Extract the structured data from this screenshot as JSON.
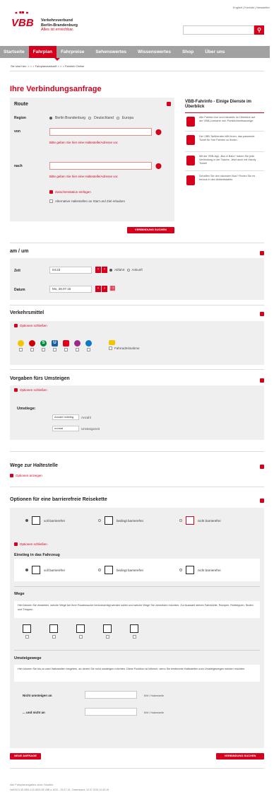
{
  "toplinks": [
    "English",
    "Kontakt",
    "Newsletter"
  ],
  "logo": {
    "mark": "VBB",
    "line1": "Verkehrsverbund",
    "line2": "Berlin-Brandenburg",
    "line3": "Alles ist erreichbar."
  },
  "nav": [
    "Startseite",
    "Fahrplan",
    "Fahrpreise",
    "Sehenswertes",
    "Wissenswertes",
    "Shop",
    "Über uns"
  ],
  "breadcrumb": "Sie sind hier: > > > Fahrplanauskunft > > > Fahrinfo Online",
  "page_title": "Ihre Verbindungsanfrage",
  "route": {
    "heading": "Route",
    "region_label": "Region",
    "regions": [
      "Berlin Brandenburg",
      "Deutschland",
      "Europa"
    ],
    "von_label": "von",
    "nach_label": "nach",
    "hint": "Bitte geben Sie hier eine Haltestelle/Adresse vor.",
    "zwischen": "Zwischenstation einfügen",
    "alternative": "Alternative Haltestellen an Start und Ziel erlauben"
  },
  "sidebar": {
    "title": "VBB-Fahrinfo - Einige Dienste im Überblick",
    "items": [
      "Alle Fahrten live und interaktiv im Überblick auf der VBB-Livekarte inkl. Pünktlichkeitsanzeige.",
      "Der VBB-Tarifberater hilft Ihnen, das passende Ticket für Ihre Fahrten zu finden.",
      "Mit der VBB-App „Bus & Bahn\" haben Sie jede Verbindung in der Tasche. Jetzt auch mit Handy Ticket!",
      "Schaffen Sie den nächsten Bus? Finden Sie es heraus in den Abfahrtstafeln."
    ]
  },
  "search_button": "VERBINDUNG SUCHEN",
  "time": {
    "heading": "am / um",
    "zeit_label": "Zeit",
    "zeit_value": "04:23",
    "abfahrt": "Abfahrt",
    "ankunft": "Ankunft",
    "datum_label": "Datum",
    "datum_value": "Mo, 28.07.15"
  },
  "verkehrsmittel": {
    "heading": "Verkehrsmittel",
    "toggle": "Optionen schließen",
    "fahrrad": "Fahrradmitnahme",
    "modes": [
      {
        "name": "regional-icon",
        "letter": "R",
        "color": "#cc0000"
      },
      {
        "name": "s-bahn-icon",
        "letter": "S",
        "color": "#008d3f"
      },
      {
        "name": "u-bahn-icon",
        "letter": "U",
        "color": "#1a5ea8"
      },
      {
        "name": "tram-icon",
        "letter": "Tram",
        "color": "#e2001a"
      },
      {
        "name": "bus-icon",
        "letter": "Bus",
        "color": "#9b2a89"
      },
      {
        "name": "ferry-icon",
        "letter": "F",
        "color": "#0a7ac6"
      }
    ]
  },
  "umstieg": {
    "heading": "Vorgaben fürs Umsteigen",
    "toggle": "Optionen schließen",
    "label": "Umstiege:",
    "anzahl_value": "Anzahl beliebig",
    "anzahl_label": "Anzahl",
    "zeit_value": "normal",
    "zeit_label": "Umsteigezeit"
  },
  "wege": {
    "heading": "Wege zur Haltestelle",
    "toggle": "Optionen anzeigen"
  },
  "barriere": {
    "heading": "Optionen für eine barrierefreie Reisekette",
    "options": [
      "voll barrierefrei",
      "bedingt barrierefrei",
      "nicht barrierefrei"
    ],
    "toggle": "Optionen schließen",
    "einstieg_heading": "Einstieg in das Fahrzeug",
    "einstieg_options": [
      "voll barrierefrei",
      "bedingt barrierefrei",
      "nicht barrierefrei"
    ]
  },
  "wege2": {
    "heading": "Wege",
    "text": "Hier können Sie einstellen, welche Wege bei Ihrer Routensuche berücksichtigt werden sollen und welche Wege Sie vermeiden möchten. Zur Auswahl stehen Fahrstühle, Rampen, Rolltreppen, Stufen und Treppen."
  },
  "umsteigewege": {
    "heading": "Umsteigewege",
    "text": "Hier können Sie bis zu zwei Haltestellen eingeben, an denen Sie nicht umsteigen möchten. Diese Funktion ist hilfreich, wenn Sie bestimmte Haltestellen zum Umsteigewegen meiden möchten.",
    "row1_label": "Nicht umsteigen an",
    "row2_label": "... und nicht an",
    "unit": "Bhf / Haltestelle"
  },
  "neue_anfrage": "NEUE ANFRAGE",
  "footer": {
    "line1": "Alle Fahrplanangaben ohne Gewähr.",
    "line2": "HaFAS 5.35.VBB.4.16.2825.28 VBB a 1E32 - 29.07.15 - Datenstand: 10.07.2015 10:43:15"
  },
  "colors": {
    "accent": "#d7001c",
    "nav_bg": "#a1a1a1",
    "panel_bg": "#efefef"
  }
}
